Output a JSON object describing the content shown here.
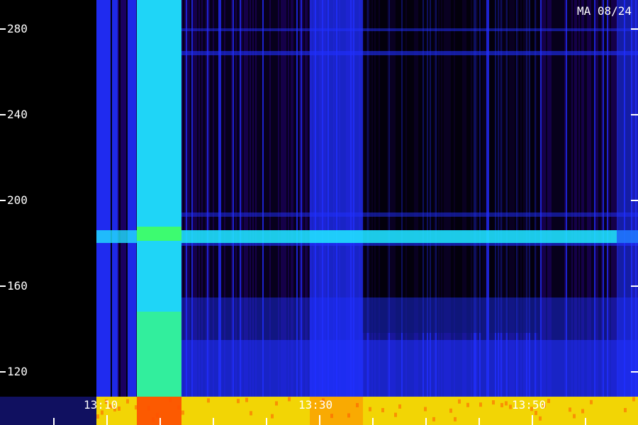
{
  "station_label": "MA 08/24",
  "y_axis": {
    "ticks": [
      "280",
      "240",
      "200",
      "160",
      "120"
    ]
  },
  "x_axis": {
    "labels": [
      "13:10",
      "13:30",
      "13:50"
    ]
  },
  "colors": {
    "background": "#000000",
    "low": "#1a0060",
    "mid": "#2030ff",
    "high": "#20e0ff",
    "peak": "#40ff60",
    "hot": "#ffe000",
    "hottest": "#ff3000"
  }
}
